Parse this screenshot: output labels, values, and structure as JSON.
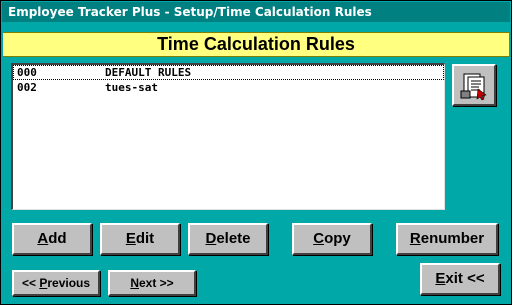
{
  "window": {
    "title": "Employee Tracker Plus - Setup/Time Calculation Rules"
  },
  "banner": {
    "title": "Time Calculation Rules"
  },
  "rules": [
    {
      "code": "000",
      "name": "DEFAULT RULES"
    },
    {
      "code": "002",
      "name": "tues-sat"
    }
  ],
  "buttons": {
    "add": {
      "u": "A",
      "rest": "dd"
    },
    "edit": {
      "u": "E",
      "rest": "dit"
    },
    "delete": {
      "u": "D",
      "rest": "elete"
    },
    "copy": {
      "u": "C",
      "rest": "opy"
    },
    "renumber": {
      "u": "R",
      "rest": "enumber"
    },
    "previous": {
      "pre": "<< ",
      "u": "P",
      "rest": "revious"
    },
    "next": {
      "u": "N",
      "rest": "ext >>"
    },
    "exit": {
      "u": "E",
      "rest": "xit <<"
    }
  },
  "icons": {
    "report": "report-icon"
  },
  "colors": {
    "background": "#00a8a8",
    "titlebar": "#008080",
    "banner": "#ffff80",
    "button": "#c0c0c0"
  }
}
